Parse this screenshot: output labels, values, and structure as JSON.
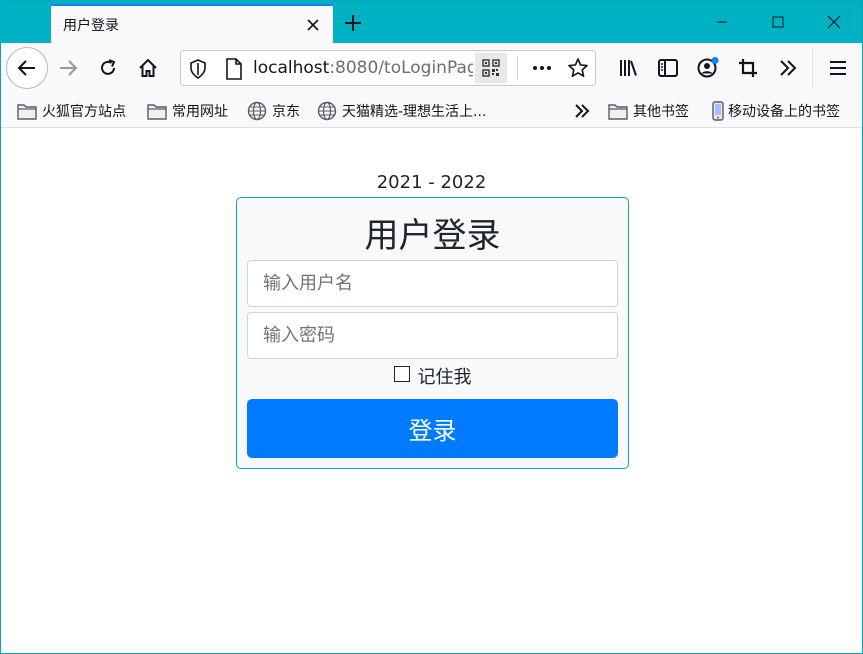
{
  "tab": {
    "title": "用户登录"
  },
  "urlbar": {
    "host": "localhost",
    "rest": ":8080/toLoginPag"
  },
  "bookmarks": [
    {
      "label": "火狐官方站点",
      "icon": "folder-icon"
    },
    {
      "label": "常用网址",
      "icon": "folder-icon"
    },
    {
      "label": "京东",
      "icon": "globe-icon"
    },
    {
      "label": "天猫精选-理想生活上...",
      "icon": "globe-icon"
    },
    {
      "label": "其他书签",
      "icon": "folder-icon"
    },
    {
      "label": "移动设备上的书签",
      "icon": "mobile-icon"
    }
  ],
  "page": {
    "year": "2021 - 2022",
    "login_title": "用户登录",
    "username_placeholder": "输入用户名",
    "password_placeholder": "输入密码",
    "remember_label": "记住我",
    "login_button": "登录"
  },
  "colors": {
    "titlebar": "#00b0c3",
    "card_border": "#17a2b8",
    "button": "#007bff"
  }
}
